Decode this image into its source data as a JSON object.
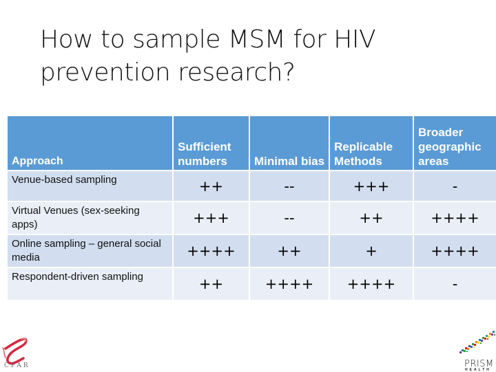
{
  "slide": {
    "title": "How to sample MSM for HIV prevention research?"
  },
  "table": {
    "headers": [
      "Approach",
      "Sufficient numbers",
      "Minimal bias",
      "Replicable Methods",
      "Broader geographic areas"
    ],
    "rows": [
      {
        "approach": "Venue-based sampling",
        "ratings": [
          "++",
          "--",
          "+++",
          "-"
        ]
      },
      {
        "approach": "Virtual Venues (sex-seeking apps)",
        "ratings": [
          "+++",
          "--",
          "++",
          "++++"
        ]
      },
      {
        "approach": "Online sampling – general social media",
        "ratings": [
          "++++",
          "++",
          "+",
          "++++"
        ]
      },
      {
        "approach": "Respondent-driven sampling",
        "ratings": [
          "++",
          "++++",
          "++++",
          "-"
        ]
      }
    ],
    "colors": {
      "header": "#5B9BD5",
      "row_odd": "#D2DEEF",
      "row_even": "#EAEFF7"
    }
  },
  "logos": {
    "left": {
      "icon": "cfar-ribbon-e-logo",
      "text": "CFAR"
    },
    "right": {
      "icon": "prism-rainbow-swoosh-logo",
      "text": "PRISM",
      "subtext": "HEALTH"
    }
  }
}
